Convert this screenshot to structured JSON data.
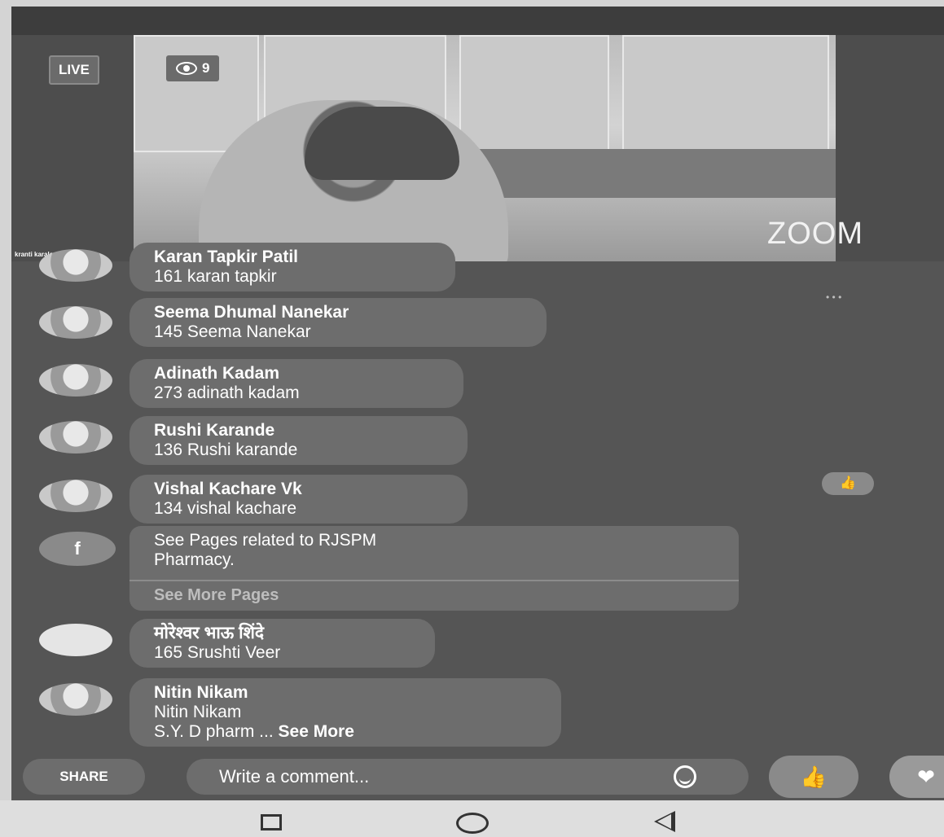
{
  "live": {
    "badge": "LIVE",
    "viewers": "9",
    "host_name": "kranti karale",
    "video_watermark": "ZOOM"
  },
  "comments": [
    {
      "name": "Karan Tapkir Patil",
      "text": "161 karan tapkir"
    },
    {
      "name": "Seema Dhumal Nanekar",
      "text": "145 Seema Nanekar"
    },
    {
      "name": "Adinath Kadam",
      "text": "273 adinath kadam"
    },
    {
      "name": "Rushi Karande",
      "text": "136 Rushi karande"
    },
    {
      "name": "Vishal Kachare Vk",
      "text": "134 vishal kachare"
    },
    {
      "name": "मोरेश्वर भाऊ शिंदे",
      "text": "165 Srushti  Veer"
    },
    {
      "name": "Nitin Nikam",
      "text": "Nitin Nikam",
      "text2": "S.Y. D pharm ... ",
      "see_more": "See More"
    }
  ],
  "pages_card": {
    "line1": "See Pages related to RJSPM",
    "line2": "Pharmacy.",
    "more": "See More Pages"
  },
  "bottom": {
    "share": "SHARE",
    "comment_placeholder": "Write a comment..."
  }
}
